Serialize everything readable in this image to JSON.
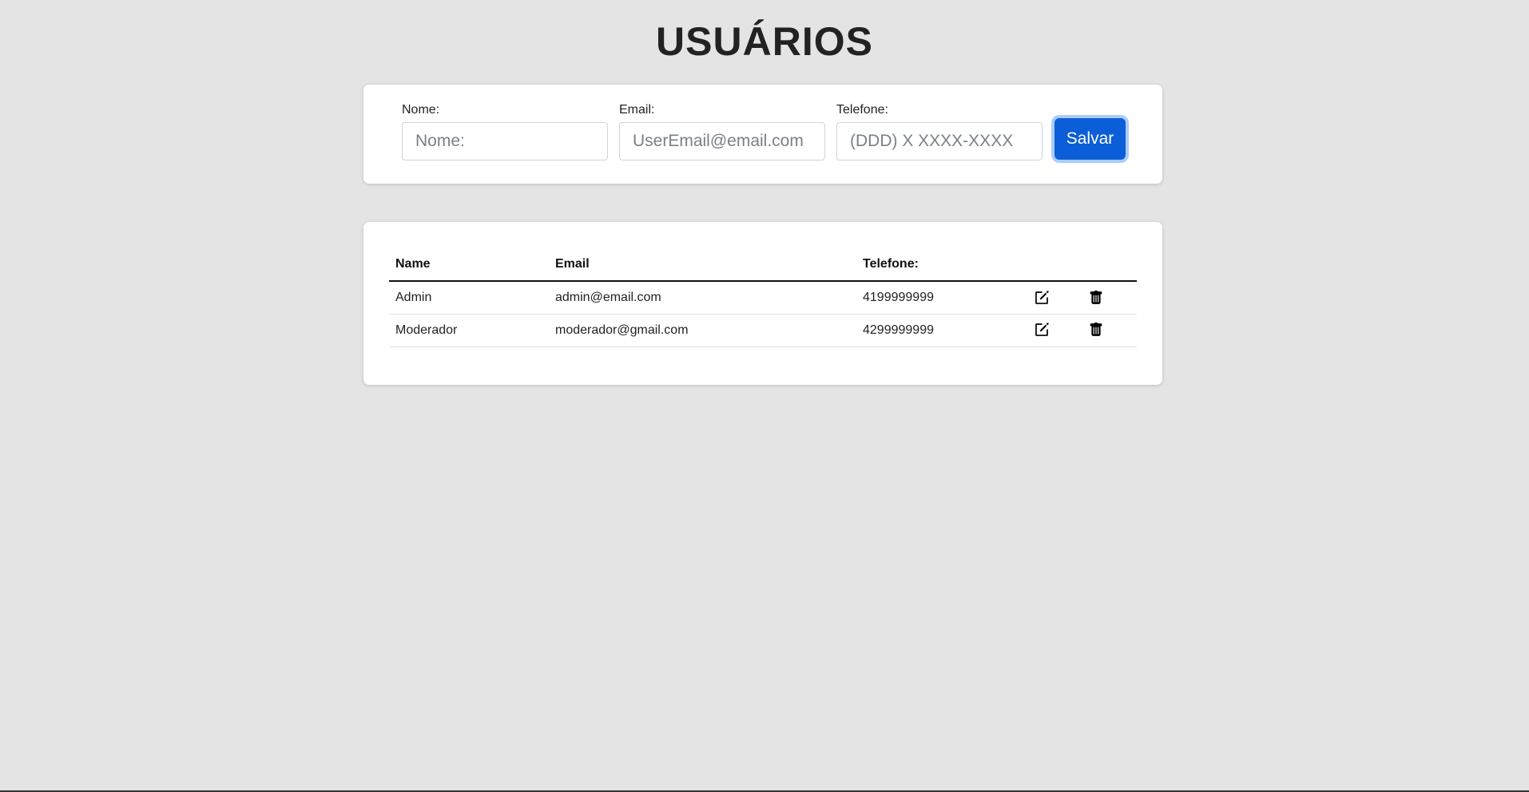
{
  "page": {
    "title": "USUÁRIOS"
  },
  "form": {
    "name_label": "Nome:",
    "name_placeholder": "Nome:",
    "email_label": "Email:",
    "email_placeholder": "UserEmail@email.com",
    "phone_label": "Telefone:",
    "phone_placeholder": "(DDD) X XXXX-XXXX",
    "save_label": "Salvar"
  },
  "table": {
    "headers": {
      "name": "Name",
      "email": "Email",
      "phone": "Telefone:"
    },
    "rows": [
      {
        "name": "Admin",
        "email": "admin@email.com",
        "phone": "4199999999"
      },
      {
        "name": "Moderador",
        "email": "moderador@gmail.com",
        "phone": "4299999999"
      }
    ]
  },
  "icons": {
    "edit": "edit-icon",
    "delete": "trash-icon"
  },
  "colors": {
    "background": "#e4e4e4",
    "primary_button": "#0b5ed7"
  }
}
